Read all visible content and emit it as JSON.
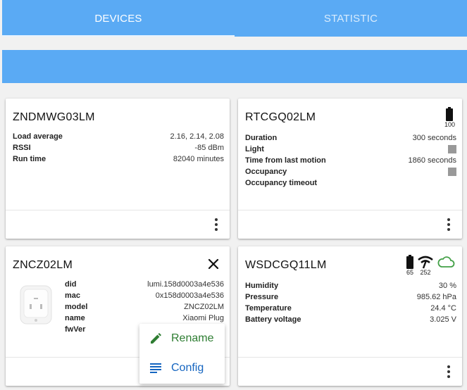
{
  "tabs": [
    {
      "label": "DEVICES",
      "active": true
    },
    {
      "label": "STATISTIC",
      "active": false
    }
  ],
  "colors": {
    "primary": "#5aaaf4",
    "rename": "#2e7d32",
    "config": "#1565c0",
    "cloud": "#43a047"
  },
  "cards": {
    "zndmwg": {
      "title": "ZNDMWG03LM",
      "props": [
        {
          "name": "Load average",
          "value": "2.16, 2.14, 2.08"
        },
        {
          "name": "RSSI",
          "value": "-85 dBm"
        },
        {
          "name": "Run time",
          "value": "82040 minutes"
        }
      ]
    },
    "rtcgq": {
      "title": "RTCGQ02LM",
      "battery": "100",
      "props": [
        {
          "name": "Duration",
          "value": "300 seconds"
        },
        {
          "name": "Light",
          "value": ""
        },
        {
          "name": "Time from last motion",
          "value": "1860 seconds"
        },
        {
          "name": "Occupancy",
          "value": ""
        },
        {
          "name": "Occupancy timeout",
          "value": ""
        }
      ]
    },
    "zncz": {
      "title": "ZNCZ02LM",
      "props": [
        {
          "name": "did",
          "value": "lumi.158d0003a4e536"
        },
        {
          "name": "mac",
          "value": "0x158d0003a4e536"
        },
        {
          "name": "model",
          "value": "ZNCZ02LM"
        },
        {
          "name": "name",
          "value": "Xiaomi Plug"
        },
        {
          "name": "fwVer",
          "value": ""
        }
      ],
      "menu": {
        "rename": "Rename",
        "config": "Config"
      }
    },
    "wsdcgq": {
      "title": "WSDCGQ11LM",
      "battery": "65",
      "link_quality": "252",
      "props": [
        {
          "name": "Humidity",
          "value": "30 %"
        },
        {
          "name": "Pressure",
          "value": "985.62 hPa"
        },
        {
          "name": "Temperature",
          "value": "24.4 °C"
        },
        {
          "name": "Battery voltage",
          "value": "3.025 V"
        }
      ]
    }
  }
}
